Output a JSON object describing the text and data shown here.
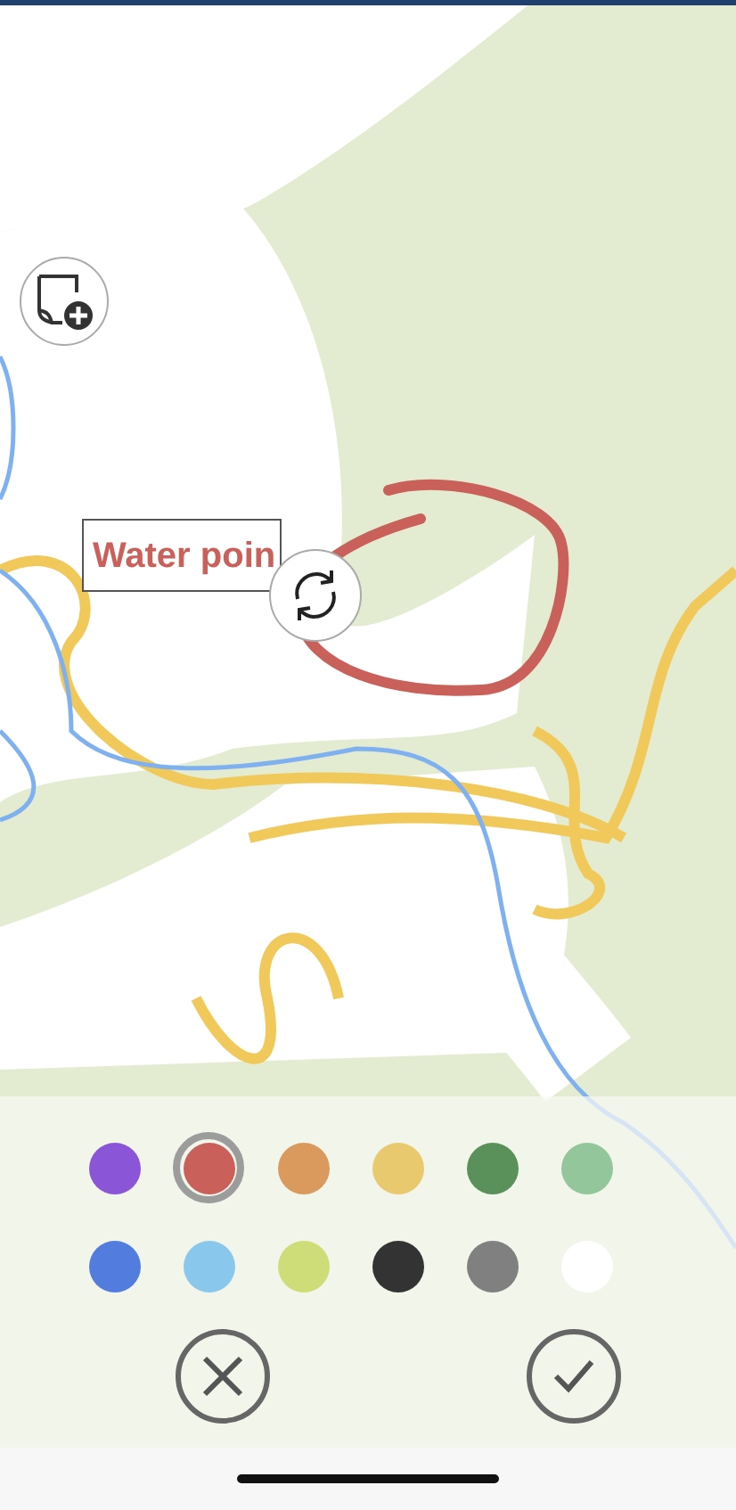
{
  "annotation": {
    "label": "Water poin"
  },
  "palette": {
    "colors": [
      {
        "color": "#8a55d6",
        "selected": false
      },
      {
        "color": "#c9605a",
        "selected": true
      },
      {
        "color": "#da9a5e",
        "selected": false
      },
      {
        "color": "#e8c96e",
        "selected": false
      },
      {
        "color": "#5a905a",
        "selected": false
      },
      {
        "color": "#93c79b",
        "selected": false
      },
      {
        "color": "#527ddf",
        "selected": false
      },
      {
        "color": "#8ac7ec",
        "selected": false
      },
      {
        "color": "#cfdd78",
        "selected": false
      },
      {
        "color": "#333333",
        "selected": false
      },
      {
        "color": "#808080",
        "selected": false
      },
      {
        "color": "#ffffff",
        "selected": false
      }
    ]
  }
}
